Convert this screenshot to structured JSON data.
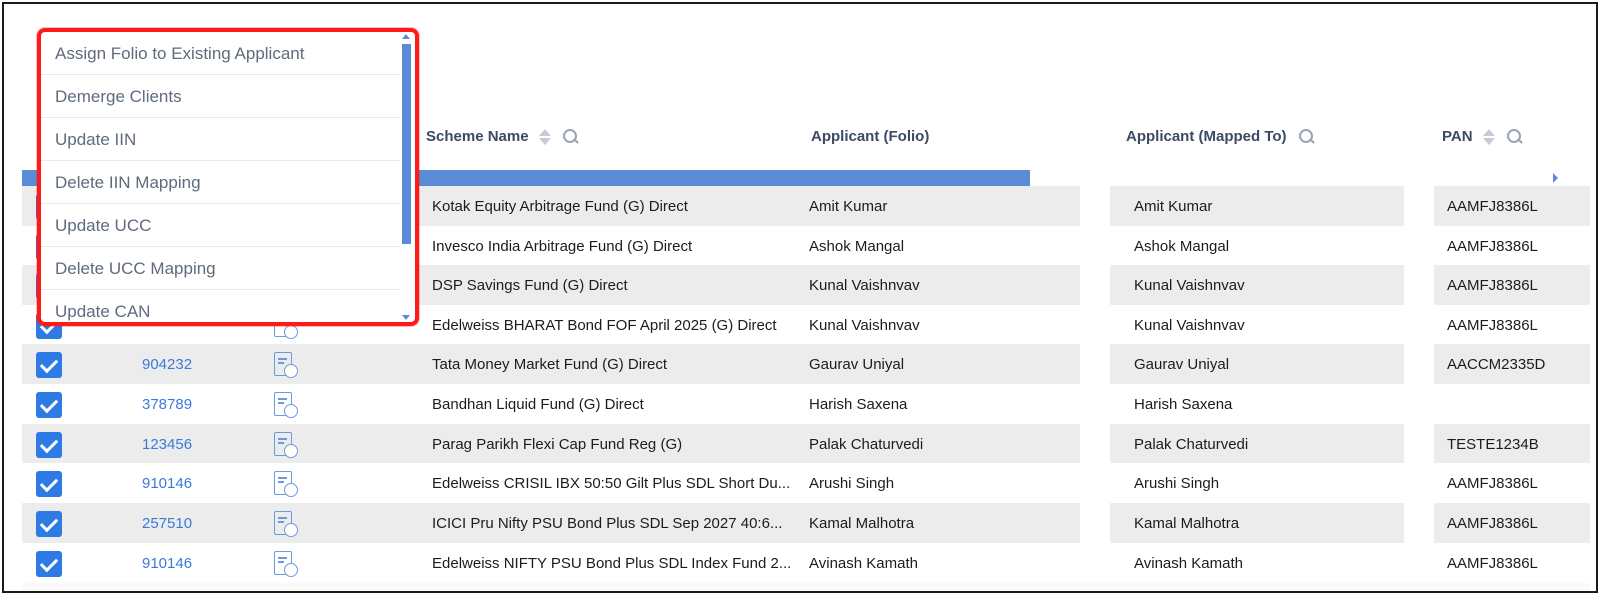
{
  "columns": {
    "scheme_name": "Scheme Name",
    "applicant_folio": "Applicant (Folio)",
    "applicant_mapped": "Applicant (Mapped To)",
    "pan": "PAN"
  },
  "dropdown": {
    "items": [
      "Assign Folio to Existing Applicant",
      "Demerge Clients",
      "Update IIN",
      "Delete IIN Mapping",
      "Update UCC",
      "Delete UCC Mapping",
      "Update CAN"
    ]
  },
  "rows": [
    {
      "folio": "",
      "scheme": "Kotak Equity Arbitrage Fund (G) Direct",
      "applicant": "Amit Kumar",
      "mapped": "Amit Kumar",
      "pan": "AAMFJ8386L"
    },
    {
      "folio": "",
      "scheme": "Invesco India Arbitrage Fund (G) Direct",
      "applicant": "Ashok Mangal",
      "mapped": "Ashok Mangal",
      "pan": "AAMFJ8386L"
    },
    {
      "folio": "",
      "scheme": "DSP Savings Fund (G) Direct",
      "applicant": "Kunal Vaishnvav",
      "mapped": "Kunal Vaishnvav",
      "pan": "AAMFJ8386L"
    },
    {
      "folio": "",
      "scheme": "Edelweiss BHARAT Bond FOF April 2025 (G) Direct",
      "applicant": "Kunal Vaishnvav",
      "mapped": "Kunal Vaishnvav",
      "pan": "AAMFJ8386L"
    },
    {
      "folio": "904232",
      "scheme": "Tata Money Market Fund (G) Direct",
      "applicant": "Gaurav Uniyal",
      "mapped": "Gaurav Uniyal",
      "pan": "AACCM2335D"
    },
    {
      "folio": "378789",
      "scheme": "Bandhan Liquid Fund (G) Direct",
      "applicant": "Harish Saxena",
      "mapped": "Harish Saxena",
      "pan": ""
    },
    {
      "folio": "123456",
      "scheme": "Parag Parikh Flexi Cap Fund Reg (G)",
      "applicant": "Palak Chaturvedi",
      "mapped": "Palak Chaturvedi",
      "pan": "TESTE1234B"
    },
    {
      "folio": "910146",
      "scheme": "Edelweiss CRISIL IBX 50:50 Gilt Plus SDL Short Du...",
      "applicant": "Arushi Singh",
      "mapped": "Arushi Singh",
      "pan": "AAMFJ8386L"
    },
    {
      "folio": "257510",
      "scheme": "ICICI Pru Nifty PSU Bond Plus SDL Sep 2027 40:6...",
      "applicant": "Kamal Malhotra",
      "mapped": "Kamal Malhotra",
      "pan": "AAMFJ8386L"
    },
    {
      "folio": "910146",
      "scheme": "Edelweiss NIFTY PSU Bond Plus SDL Index Fund 2...",
      "applicant": "Avinash Kamath",
      "mapped": "Avinash Kamath",
      "pan": "AAMFJ8386L"
    }
  ],
  "colors": {
    "accent": "#2e7be6",
    "link": "#3a7ad9",
    "highlight_border": "#ff1a1a",
    "scrollbar": "#5b8bd6"
  },
  "icons": [
    "search-icon",
    "sort-icon",
    "checkbox-checked-icon",
    "document-rupee-icon"
  ]
}
